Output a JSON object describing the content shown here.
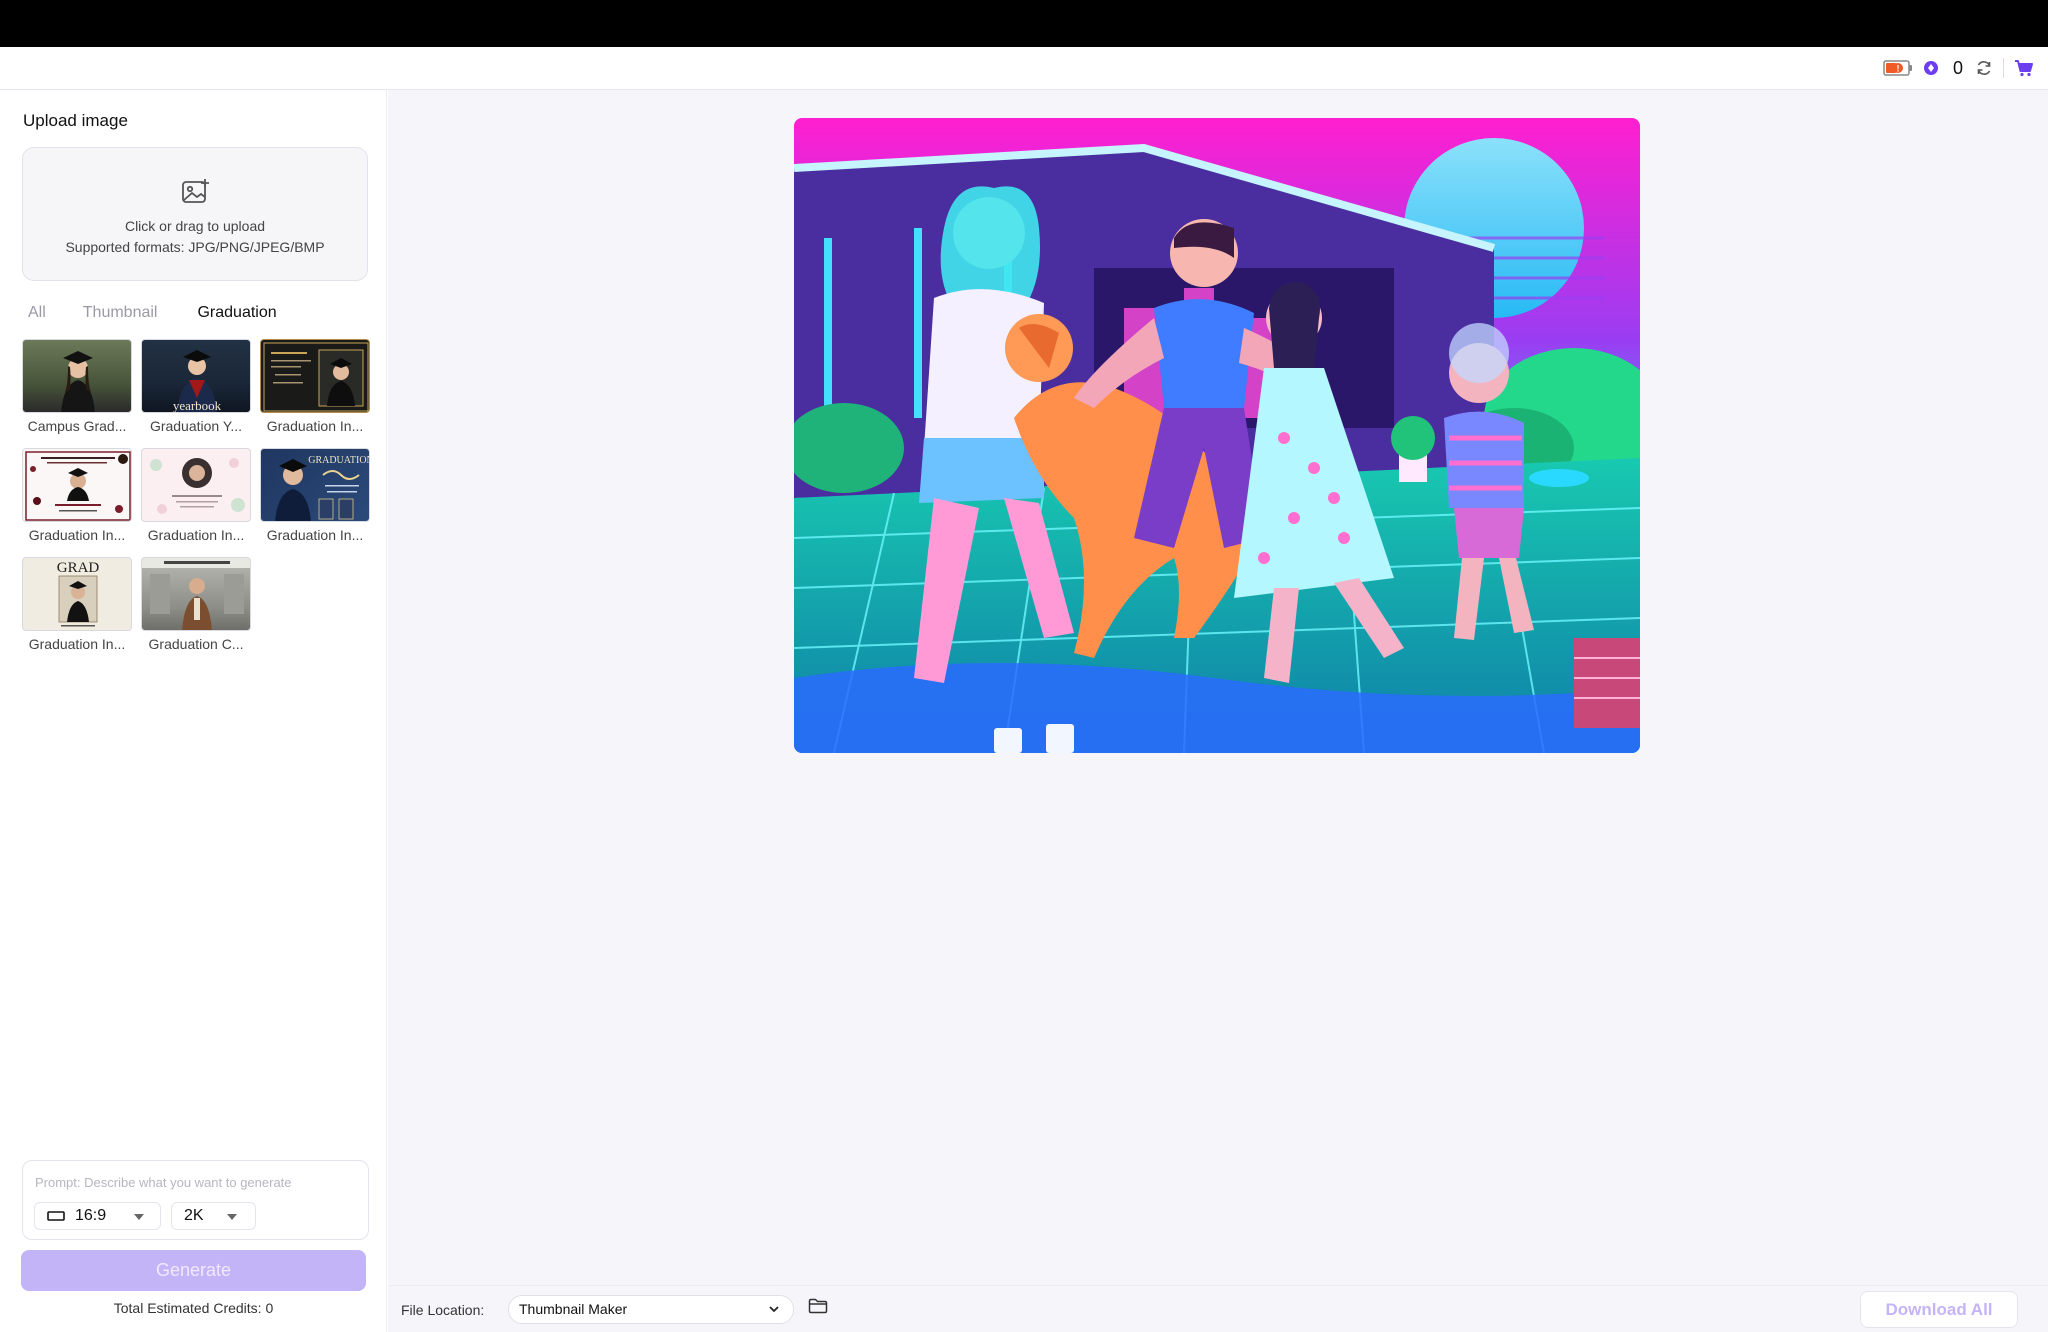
{
  "header": {
    "credit_count": "0"
  },
  "sidebar": {
    "upload_title": "Upload image",
    "upload_line1": "Click or drag to upload",
    "upload_line2": "Supported formats: JPG/PNG/JPEG/BMP",
    "tabs": [
      {
        "label": "All",
        "active": false
      },
      {
        "label": "Thumbnail",
        "active": false
      },
      {
        "label": "Graduation",
        "active": true
      }
    ],
    "templates": [
      {
        "label": "Campus Grad..."
      },
      {
        "label": "Graduation Y..."
      },
      {
        "label": "Graduation In..."
      },
      {
        "label": "Graduation In..."
      },
      {
        "label": "Graduation In..."
      },
      {
        "label": "Graduation In..."
      },
      {
        "label": "Graduation In..."
      },
      {
        "label": "Graduation C..."
      }
    ],
    "template_texts": {
      "yearbook": "yearbook",
      "grad": "GRAD",
      "graduation": "GRADUATION"
    },
    "prompt_placeholder": "Prompt: Describe what you want to generate",
    "aspect_ratio": "16:9",
    "resolution": "2K",
    "generate_label": "Generate",
    "credits_text": "Total Estimated Credits: 0"
  },
  "footer": {
    "file_location_label": "File Location:",
    "file_location_value": "Thumbnail Maker",
    "download_all_label": "Download All"
  },
  "colors": {
    "accent": "#7b4dff",
    "generate_disabled": "#c3b3f7",
    "main_bg": "#f6f6fa"
  }
}
